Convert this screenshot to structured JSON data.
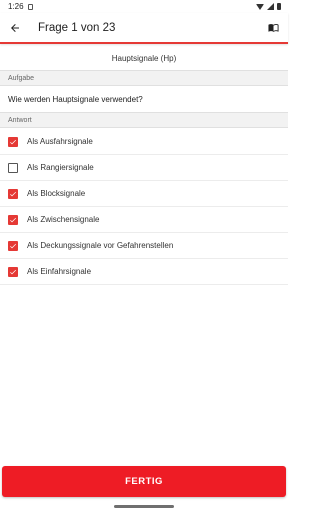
{
  "status_bar": {
    "time": "1:26"
  },
  "app_bar": {
    "title": "Frage 1 von 23"
  },
  "topic": "Hauptsignale (Hp)",
  "task": {
    "header": "Aufgabe",
    "question": "Wie werden Hauptsignale verwendet?"
  },
  "answers_header": "Antwort",
  "answers": [
    {
      "label": "Als Ausfahrsignale",
      "checked": true
    },
    {
      "label": "Als Rangiersignale",
      "checked": false
    },
    {
      "label": "Als Blocksignale",
      "checked": true
    },
    {
      "label": "Als Zwischensignale",
      "checked": true
    },
    {
      "label": "Als Deckungssignale vor Gefahrenstellen",
      "checked": true
    },
    {
      "label": "Als Einfahrsignale",
      "checked": true
    }
  ],
  "button": {
    "label": "FERTIG"
  },
  "colors": {
    "accent": "#e53935",
    "button": "#ee1c25",
    "section_bg": "#f2f2f2"
  }
}
